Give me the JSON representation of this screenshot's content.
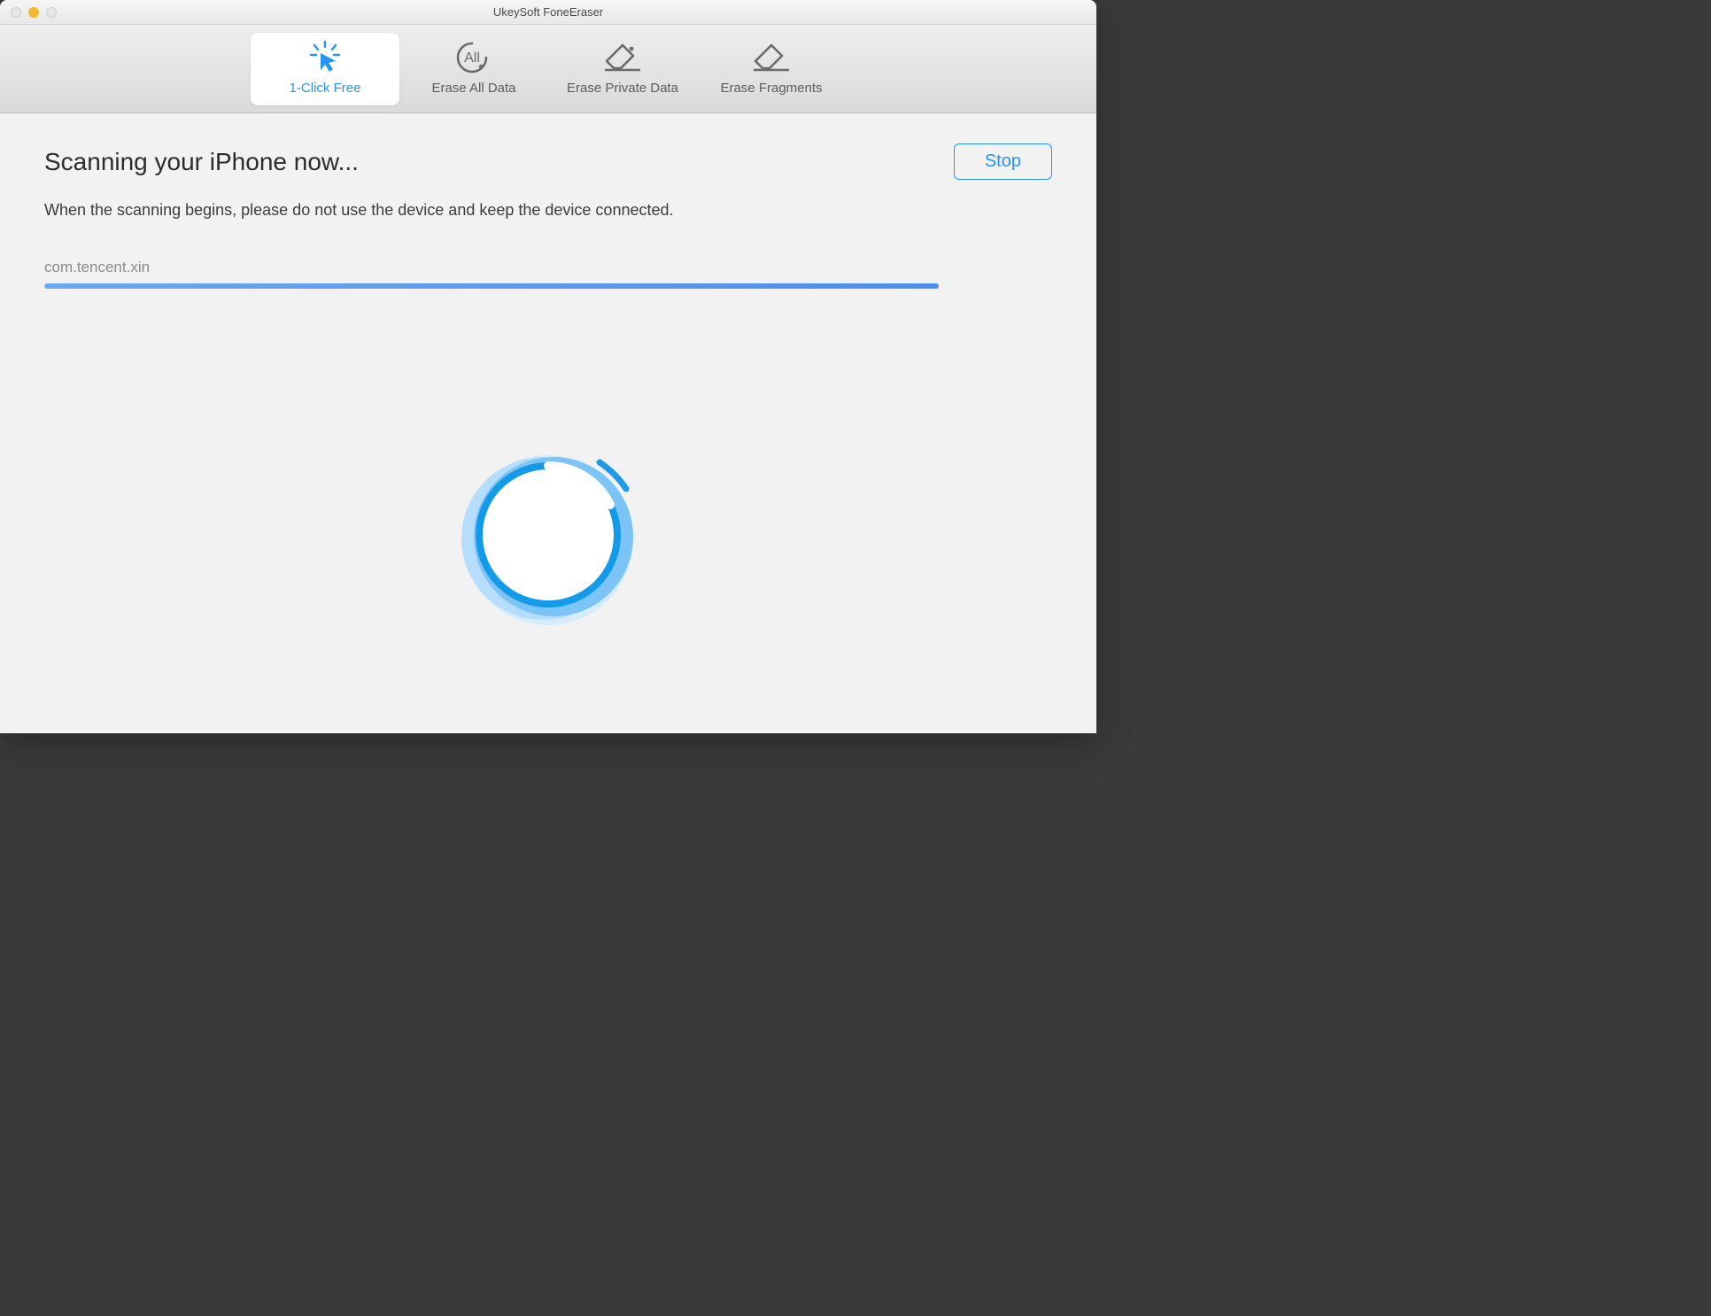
{
  "window": {
    "title": "UkeySoft FoneEraser"
  },
  "tabs": [
    {
      "label": "1-Click Free",
      "active": true
    },
    {
      "label": "Erase All Data",
      "active": false
    },
    {
      "label": "Erase Private Data",
      "active": false
    },
    {
      "label": "Erase Fragments",
      "active": false
    }
  ],
  "main": {
    "heading": "Scanning your iPhone now...",
    "subtext": "When the scanning begins, please do not use the device and keep the device connected.",
    "current_item": "com.tencent.xin",
    "progress_percent": 100,
    "stop_label": "Stop"
  },
  "colors": {
    "accent": "#2793f2"
  }
}
